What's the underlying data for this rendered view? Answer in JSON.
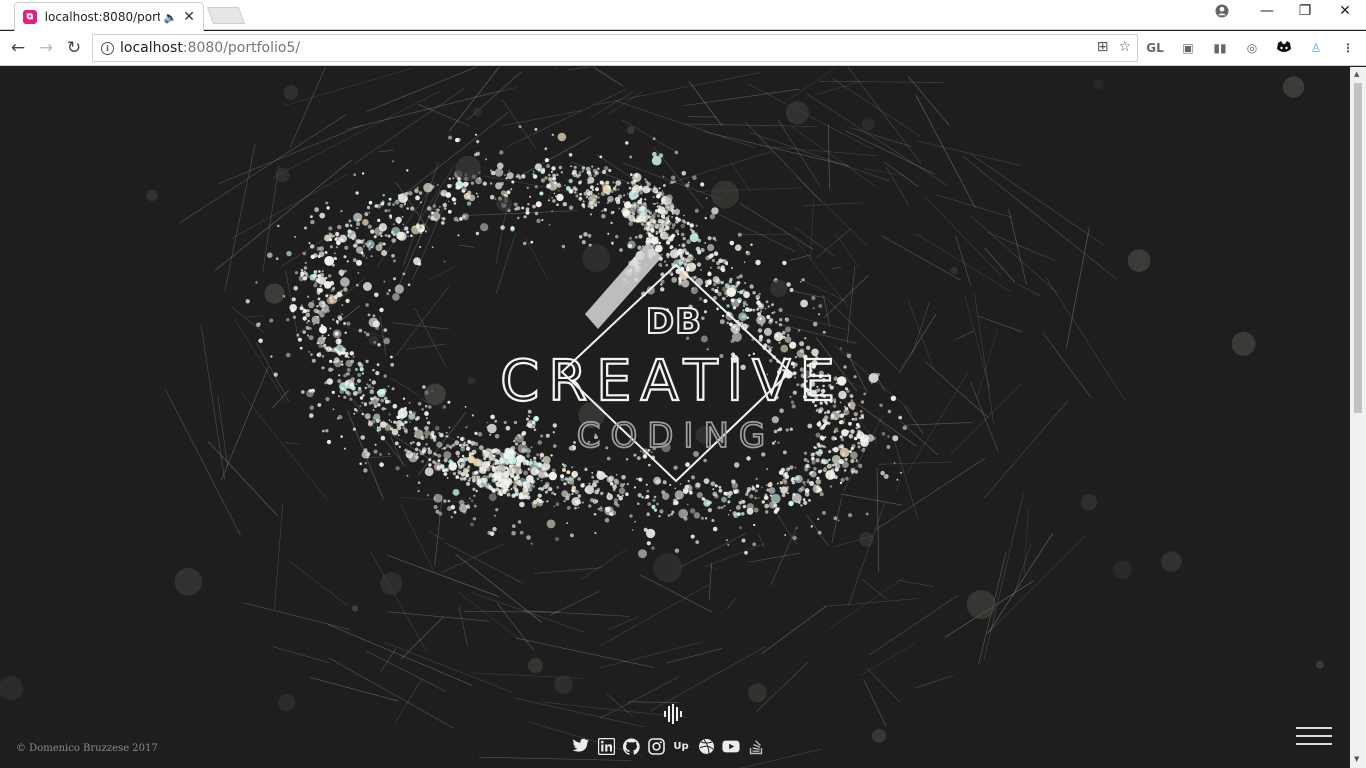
{
  "browser": {
    "tab_title": "localhost:8080/portfolio5/",
    "url_host": "localhost",
    "url_rest": ":8080/portfolio5/",
    "extensions": [
      "GL",
      "",
      "",
      "",
      "",
      ""
    ]
  },
  "page": {
    "logo_initials": "DB",
    "logo_line1": "CREATIVE",
    "logo_line2": "CODING",
    "copyright": "© Domenico Bruzzese 2017"
  },
  "socials": [
    {
      "name": "twitter-icon",
      "glyph": ""
    },
    {
      "name": "linkedin-icon",
      "glyph": "in"
    },
    {
      "name": "github-icon",
      "glyph": ""
    },
    {
      "name": "instagram-icon",
      "glyph": ""
    },
    {
      "name": "upwork-icon",
      "glyph": "Up"
    },
    {
      "name": "dribbble-icon",
      "glyph": ""
    },
    {
      "name": "youtube-icon",
      "glyph": ""
    },
    {
      "name": "stackoverflow-icon",
      "glyph": ""
    }
  ],
  "colors": {
    "background": "#1e1e1e",
    "particle": "#f4f4f0",
    "accent_cyan": "#9ff4ee",
    "favicon": "#e4217f"
  }
}
